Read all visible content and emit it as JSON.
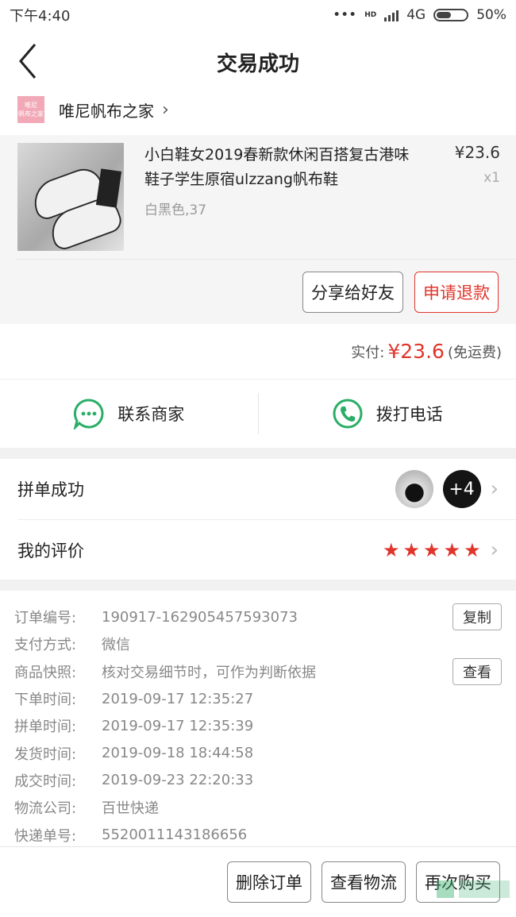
{
  "status_bar": {
    "time": "下午4:40",
    "network": "4G",
    "hd": "HD",
    "battery": "50%",
    "battery_level": 0.5
  },
  "nav": {
    "title": "交易成功"
  },
  "shop": {
    "logo_text": "唯尼\n帆布之家",
    "name": "唯尼帆布之家"
  },
  "product": {
    "title": "小白鞋女2019春新款休闲百搭复古港味鞋子学生原宿ulzzang帆布鞋",
    "spec": "白黑色,37",
    "price": "¥23.6",
    "qty": "x1"
  },
  "actions": {
    "share": "分享给好友",
    "refund": "申请退款"
  },
  "payment": {
    "label": "实付:",
    "amount": "¥23.6",
    "note": "(免运费)"
  },
  "contact": {
    "merchant": "联系商家",
    "call": "拨打电话"
  },
  "group": {
    "label": "拼单成功",
    "extra": "+4"
  },
  "review": {
    "label": "我的评价",
    "stars": 5
  },
  "details": [
    {
      "label": "订单编号:",
      "value": "190917-162905457593073",
      "button": "复制"
    },
    {
      "label": "支付方式:",
      "value": "微信"
    },
    {
      "label": "商品快照:",
      "value": "核对交易细节时，可作为判断依据",
      "button": "查看"
    },
    {
      "label": "下单时间:",
      "value": "2019-09-17 12:35:27"
    },
    {
      "label": "拼单时间:",
      "value": "2019-09-17 12:35:39"
    },
    {
      "label": "发货时间:",
      "value": "2019-09-18 18:44:58"
    },
    {
      "label": "成交时间:",
      "value": "2019-09-23 22:20:33"
    },
    {
      "label": "物流公司:",
      "value": "百世快递"
    },
    {
      "label": "快递单号:",
      "value": "5520011143186656"
    }
  ],
  "bottom": {
    "delete": "删除订单",
    "logistics": "查看物流",
    "rebuy": "再次购买"
  },
  "watermark": "JiChengXin.com",
  "colors": {
    "accent": "#e0352b",
    "wechat_green": "#2aae67"
  }
}
